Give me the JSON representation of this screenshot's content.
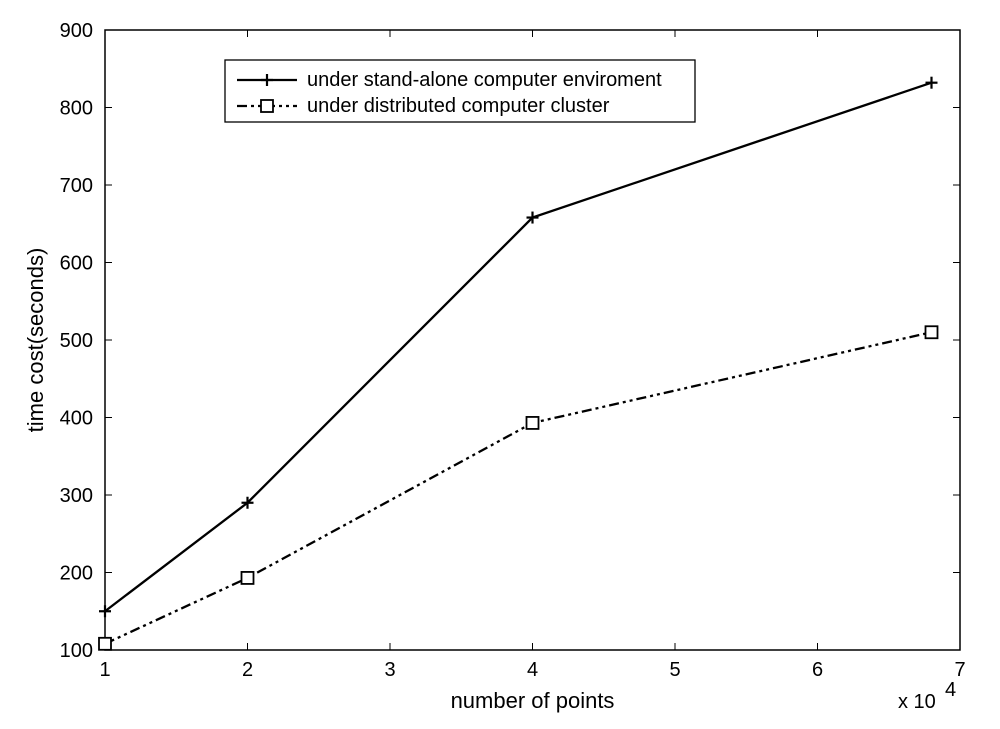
{
  "chart_data": {
    "type": "line",
    "title": "",
    "xlabel": "number of points",
    "ylabel": "time cost(seconds)",
    "x_multiplier_label": "x 10",
    "x_multiplier_exp": "4",
    "xlim": [
      1,
      7
    ],
    "ylim": [
      100,
      900
    ],
    "xticks": [
      1,
      2,
      3,
      4,
      5,
      6,
      7
    ],
    "yticks": [
      100,
      200,
      300,
      400,
      500,
      600,
      700,
      800,
      900
    ],
    "x": [
      1,
      2,
      4,
      6.8
    ],
    "series": [
      {
        "name": "under stand-alone computer enviroment",
        "values": [
          150,
          290,
          658,
          832
        ]
      },
      {
        "name": "under distributed computer cluster",
        "values": [
          108,
          193,
          393,
          510
        ]
      }
    ],
    "legend_position": "top"
  }
}
